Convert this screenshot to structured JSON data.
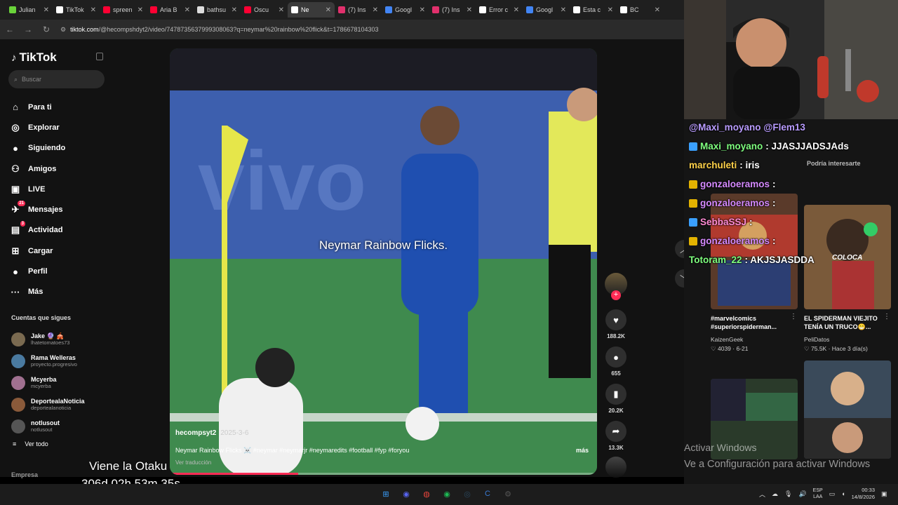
{
  "browser": {
    "tabs": [
      {
        "label": "Julian",
        "color": "#6ad43a"
      },
      {
        "label": "TikTok",
        "color": "#ffffff"
      },
      {
        "label": "spreen",
        "color": "#ff0033"
      },
      {
        "label": "Aria B",
        "color": "#ff0033"
      },
      {
        "label": "bathsu",
        "color": "#dddddd"
      },
      {
        "label": "Oscu",
        "color": "#ff0033"
      },
      {
        "label": "Ne",
        "color": "#ffffff",
        "active": true
      },
      {
        "label": "(7) Ins",
        "color": "#e1306c"
      },
      {
        "label": "Googl",
        "color": "#4285f4"
      },
      {
        "label": "(7) Ins",
        "color": "#e1306c"
      },
      {
        "label": "Error c",
        "color": "#ffffff"
      },
      {
        "label": "Googl",
        "color": "#4285f4"
      },
      {
        "label": "Esta c",
        "color": "#ffffff"
      },
      {
        "label": "BC",
        "color": "#ffffff"
      }
    ],
    "url_host": "tiktok.com",
    "url_path": "/@hecompshdyt2/video/7478735637999308063?q=neymar%20rainbow%20flick&t=1786678104303"
  },
  "sidebar": {
    "logo": "TikTok",
    "search_placeholder": "Buscar",
    "items": [
      {
        "label": "Para ti",
        "icon": "home-icon",
        "glyph": "⌂"
      },
      {
        "label": "Explorar",
        "icon": "compass-icon",
        "glyph": "◎"
      },
      {
        "label": "Siguiendo",
        "icon": "following-icon",
        "glyph": "●"
      },
      {
        "label": "Amigos",
        "icon": "friends-icon",
        "glyph": "⚇"
      },
      {
        "label": "LIVE",
        "icon": "live-icon",
        "glyph": "▣"
      },
      {
        "label": "Mensajes",
        "icon": "messages-icon",
        "glyph": "✈",
        "badge": "21"
      },
      {
        "label": "Actividad",
        "icon": "activity-icon",
        "glyph": "▤",
        "badge": "3"
      },
      {
        "label": "Cargar",
        "icon": "upload-icon",
        "glyph": "⊞"
      },
      {
        "label": "Perfil",
        "icon": "profile-icon",
        "glyph": "●"
      },
      {
        "label": "Más",
        "icon": "more-icon",
        "glyph": "···"
      }
    ],
    "following_title": "Cuentas que sigues",
    "following": [
      {
        "name": "Jake 🔮 🎪",
        "handle": "lhatetomatoes73",
        "color": "#7a6a50"
      },
      {
        "name": "Rama Welleras",
        "handle": "proyecto.progresivo",
        "color": "#4a7aa0"
      },
      {
        "name": "Mcyerba",
        "handle": "mcyerba",
        "color": "#a07090"
      },
      {
        "name": "DeportealaNoticia",
        "handle": "deportealanoticia",
        "color": "#8a5a3a"
      },
      {
        "name": "notlusout",
        "handle": "notlusout",
        "color": "#555555"
      }
    ],
    "see_all": "Ver todo",
    "see_all_icon": "≡",
    "footer": "Empresa"
  },
  "video": {
    "subtitle": "Neymar Rainbow Flicks.",
    "author": "hecompsyt2",
    "date": "2025-3-6",
    "description": "Neymar Rainbow Flicks ☠️ #neymar #neymarjr #neymaredits #football #fyp #foryou",
    "more": "más",
    "translation": "Ver traducción",
    "progress": 0.3,
    "actions": [
      {
        "name": "like",
        "glyph": "♥",
        "count": "188.2K"
      },
      {
        "name": "comment",
        "glyph": "●",
        "count": "655"
      },
      {
        "name": "save",
        "glyph": "▮",
        "count": "20.2K"
      },
      {
        "name": "share",
        "glyph": "➦",
        "count": "13.3K"
      }
    ]
  },
  "suggestions": {
    "title": "Podría interesarte",
    "cards": [
      {
        "title": "#marvelcomics #superiorspiderman...",
        "author": "KaizenGeek",
        "likes": "4039",
        "age": "6-21"
      },
      {
        "title": "EL SPIDERMAN VIEJITO TENÍA UN TRUCO😁...",
        "author": "PeliDatos",
        "likes": "75.5K",
        "age": "Hace 3 día(s)"
      }
    ],
    "thumb_text": "COLOCA"
  },
  "chat": [
    {
      "user": "@Maxi_moyano @Flem13",
      "msg": "",
      "color": "#b99cff",
      "icon": ""
    },
    {
      "user": "Maxi_moyano",
      "msg": ": JJASJJADSJAds",
      "color": "#7fff7f",
      "icon": "#3aa0ff"
    },
    {
      "user": "marchuleti",
      "msg": ": iris",
      "color": "#ffd24a",
      "icon": ""
    },
    {
      "user": "gonzaloeramos",
      "msg": ":",
      "color": "#d58aff",
      "icon": "#e3b300"
    },
    {
      "user": "gonzaloeramos",
      "msg": ":",
      "color": "#d58aff",
      "icon": "#e3b300"
    },
    {
      "user": "SebbaSSJ",
      "msg": ":",
      "color": "#ff8bd4",
      "icon": "#3aa0ff"
    },
    {
      "user": "gonzaloeramos",
      "msg": ":",
      "color": "#d58aff",
      "icon": "#e3b300"
    },
    {
      "user": "Totoram_22",
      "msg": ": AKJSJASDDA",
      "color": "#7fff7f",
      "icon": ""
    }
  ],
  "windows_watermark": {
    "line1": "Activar Windows",
    "line2": "Ve a Configuración para activar Windows"
  },
  "overlay": {
    "line1": "Viene la Otaku",
    "line2": "306d 02h 53m 35s"
  },
  "taskbar": {
    "apps": [
      {
        "name": "windows-start-icon",
        "glyph": "⊞",
        "color": "#3aa0ff"
      },
      {
        "name": "discord-icon",
        "glyph": "◉",
        "color": "#5865f2"
      },
      {
        "name": "chrome-icon",
        "glyph": "◍",
        "color": "#e8453c"
      },
      {
        "name": "spotify-icon",
        "glyph": "◉",
        "color": "#1db954"
      },
      {
        "name": "steam-icon",
        "glyph": "◎",
        "color": "#2a475e"
      },
      {
        "name": "c-app-icon",
        "glyph": "C",
        "color": "#3a7bd5"
      },
      {
        "name": "settings-icon",
        "glyph": "⚙",
        "color": "#555555"
      }
    ],
    "lang_top": "ESP",
    "lang_bottom": "LAA",
    "time": "00:33",
    "date": "14/8/2026"
  }
}
